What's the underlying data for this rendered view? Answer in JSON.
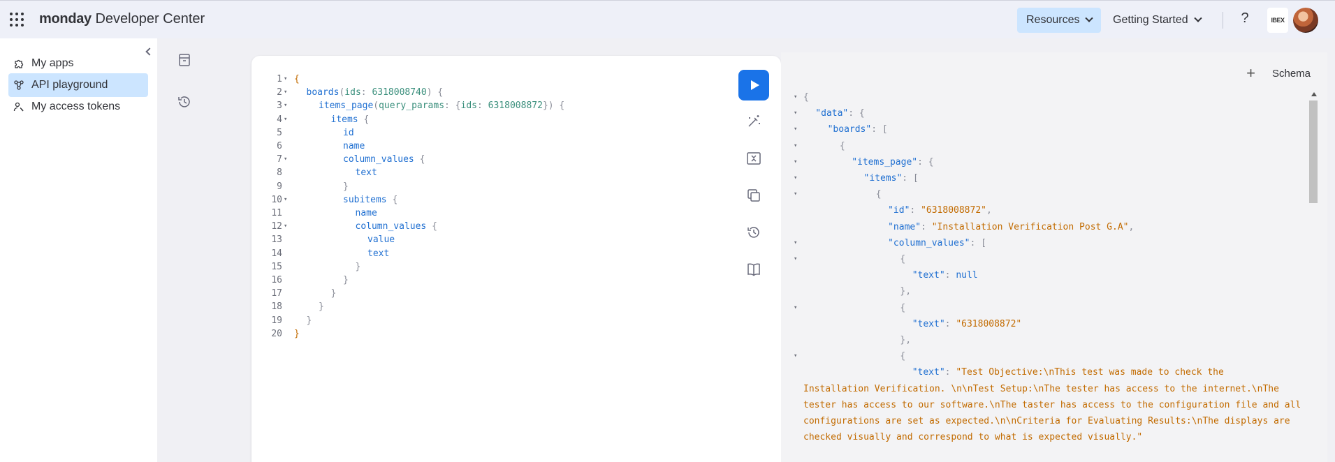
{
  "header": {
    "brand_bold": "monday",
    "brand_rest": " Developer Center",
    "resources_label": "Resources",
    "getting_started_label": "Getting Started",
    "help_label": "?",
    "logo_text": "IBEX"
  },
  "sidebar": {
    "items": [
      {
        "label": "My apps",
        "icon": "puzzle-icon"
      },
      {
        "label": "API playground",
        "icon": "network-icon",
        "active": true
      },
      {
        "label": "My access tokens",
        "icon": "key-person-icon"
      }
    ]
  },
  "editor": {
    "lines": [
      {
        "n": "1",
        "fold": "▾",
        "indent": 0,
        "parts": [
          [
            "{",
            "brace"
          ]
        ]
      },
      {
        "n": "2",
        "fold": "▾",
        "indent": 1,
        "parts": [
          [
            "boards",
            "field"
          ],
          [
            "(",
            "punc"
          ],
          [
            "ids",
            "arg"
          ],
          [
            ": ",
            "punc"
          ],
          [
            "6318008740",
            "num"
          ],
          [
            ") {",
            "punc"
          ]
        ]
      },
      {
        "n": "3",
        "fold": "▾",
        "indent": 2,
        "parts": [
          [
            "items_page",
            "field"
          ],
          [
            "(",
            "punc"
          ],
          [
            "query_params",
            "arg"
          ],
          [
            ": {",
            "punc"
          ],
          [
            "ids",
            "arg"
          ],
          [
            ": ",
            "punc"
          ],
          [
            "6318008872",
            "num"
          ],
          [
            "}) {",
            "punc"
          ]
        ]
      },
      {
        "n": "4",
        "fold": "▾",
        "indent": 3,
        "parts": [
          [
            "items",
            "field"
          ],
          [
            " {",
            "punc"
          ]
        ]
      },
      {
        "n": "5",
        "fold": "",
        "indent": 4,
        "parts": [
          [
            "id",
            "field"
          ]
        ]
      },
      {
        "n": "6",
        "fold": "",
        "indent": 4,
        "parts": [
          [
            "name",
            "field"
          ]
        ]
      },
      {
        "n": "7",
        "fold": "▾",
        "indent": 4,
        "parts": [
          [
            "column_values",
            "field"
          ],
          [
            " {",
            "punc"
          ]
        ]
      },
      {
        "n": "8",
        "fold": "",
        "indent": 5,
        "parts": [
          [
            "text",
            "field"
          ]
        ]
      },
      {
        "n": "9",
        "fold": "",
        "indent": 4,
        "parts": [
          [
            "}",
            "punc"
          ]
        ]
      },
      {
        "n": "10",
        "fold": "▾",
        "indent": 4,
        "parts": [
          [
            "subitems",
            "field"
          ],
          [
            " {",
            "punc"
          ]
        ]
      },
      {
        "n": "11",
        "fold": "",
        "indent": 5,
        "parts": [
          [
            "name",
            "field"
          ]
        ]
      },
      {
        "n": "12",
        "fold": "▾",
        "indent": 5,
        "parts": [
          [
            "column_values",
            "field"
          ],
          [
            " {",
            "punc"
          ]
        ]
      },
      {
        "n": "13",
        "fold": "",
        "indent": 6,
        "parts": [
          [
            "value",
            "field"
          ]
        ]
      },
      {
        "n": "14",
        "fold": "",
        "indent": 6,
        "parts": [
          [
            "text",
            "field"
          ]
        ]
      },
      {
        "n": "15",
        "fold": "",
        "indent": 5,
        "parts": [
          [
            "}",
            "punc"
          ]
        ]
      },
      {
        "n": "16",
        "fold": "",
        "indent": 4,
        "parts": [
          [
            "}",
            "punc"
          ]
        ]
      },
      {
        "n": "17",
        "fold": "",
        "indent": 3,
        "parts": [
          [
            "}",
            "punc"
          ]
        ]
      },
      {
        "n": "18",
        "fold": "",
        "indent": 2,
        "parts": [
          [
            "}",
            "punc"
          ]
        ]
      },
      {
        "n": "19",
        "fold": "",
        "indent": 1,
        "parts": [
          [
            "}",
            "punc"
          ]
        ]
      },
      {
        "n": "20",
        "fold": "",
        "indent": 0,
        "parts": [
          [
            "}",
            "brace"
          ]
        ]
      }
    ],
    "tools": [
      "run-icon",
      "prettify-icon",
      "merge-fragments-icon",
      "copy-icon",
      "history-icon",
      "docs-icon"
    ]
  },
  "result": {
    "add_label": "+",
    "schema_label": "Schema",
    "lines": [
      {
        "fold": "▾",
        "indent": 0,
        "parts": [
          [
            "{",
            "punc"
          ]
        ]
      },
      {
        "fold": "▾",
        "indent": 1,
        "parts": [
          [
            "\"data\"",
            "key"
          ],
          [
            ": {",
            "punc"
          ]
        ]
      },
      {
        "fold": "▾",
        "indent": 2,
        "parts": [
          [
            "\"boards\"",
            "key"
          ],
          [
            ": [",
            "punc"
          ]
        ]
      },
      {
        "fold": "▾",
        "indent": 3,
        "parts": [
          [
            "{",
            "punc"
          ]
        ]
      },
      {
        "fold": "▾",
        "indent": 4,
        "parts": [
          [
            "\"items_page\"",
            "key"
          ],
          [
            ": {",
            "punc"
          ]
        ]
      },
      {
        "fold": "▾",
        "indent": 5,
        "parts": [
          [
            "\"items\"",
            "key"
          ],
          [
            ": [",
            "punc"
          ]
        ]
      },
      {
        "fold": "▾",
        "indent": 6,
        "parts": [
          [
            "{",
            "punc"
          ]
        ]
      },
      {
        "fold": "",
        "indent": 7,
        "parts": [
          [
            "\"id\"",
            "key"
          ],
          [
            ": ",
            "punc"
          ],
          [
            "\"6318008872\"",
            "str"
          ],
          [
            ",",
            "punc"
          ]
        ]
      },
      {
        "fold": "",
        "indent": 7,
        "parts": [
          [
            "\"name\"",
            "key"
          ],
          [
            ": ",
            "punc"
          ],
          [
            "\"Installation Verification Post G.A\"",
            "str"
          ],
          [
            ",",
            "punc"
          ]
        ]
      },
      {
        "fold": "▾",
        "indent": 7,
        "parts": [
          [
            "\"column_values\"",
            "key"
          ],
          [
            ": [",
            "punc"
          ]
        ]
      },
      {
        "fold": "▾",
        "indent": 8,
        "parts": [
          [
            "{",
            "punc"
          ]
        ]
      },
      {
        "fold": "",
        "indent": 9,
        "parts": [
          [
            "\"text\"",
            "key"
          ],
          [
            ": ",
            "punc"
          ],
          [
            "null",
            "null"
          ]
        ]
      },
      {
        "fold": "",
        "indent": 8,
        "parts": [
          [
            "},",
            "punc"
          ]
        ]
      },
      {
        "fold": "▾",
        "indent": 8,
        "parts": [
          [
            "{",
            "punc"
          ]
        ]
      },
      {
        "fold": "",
        "indent": 9,
        "parts": [
          [
            "\"text\"",
            "key"
          ],
          [
            ": ",
            "punc"
          ],
          [
            "\"6318008872\"",
            "str"
          ]
        ]
      },
      {
        "fold": "",
        "indent": 8,
        "parts": [
          [
            "},",
            "punc"
          ]
        ]
      },
      {
        "fold": "▾",
        "indent": 8,
        "parts": [
          [
            "{",
            "punc"
          ]
        ]
      },
      {
        "fold": "",
        "indent": 9,
        "parts": [
          [
            "\"text\"",
            "key"
          ],
          [
            ": ",
            "punc"
          ],
          [
            "\"Test Objective:\\nThis test was made to check the",
            "str"
          ]
        ]
      }
    ],
    "wrapped_text": "Installation Verification. \\n\\nTest Setup:\\nThe tester has access to the internet.\\nThe tester has access to our software.\\nThe taster has access to the configuration file and all configurations are set as expected.\\n\\nCriteria for Evaluating Results:\\nThe displays are checked visually and correspond to what is expected visually.\""
  }
}
